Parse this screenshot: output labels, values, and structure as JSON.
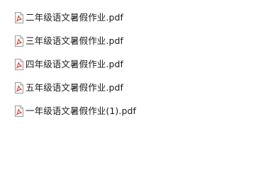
{
  "files": [
    {
      "name": "二年级语文暑假作业.pdf",
      "icon": "pdf-file-icon"
    },
    {
      "name": "三年级语文暑假作业.pdf",
      "icon": "pdf-file-icon"
    },
    {
      "name": "四年级语文暑假作业.pdf",
      "icon": "pdf-file-icon"
    },
    {
      "name": "五年级语文暑假作业.pdf",
      "icon": "pdf-file-icon"
    },
    {
      "name": "一年级语文暑假作业(1).pdf",
      "icon": "pdf-file-icon"
    }
  ],
  "colors": {
    "pdf_accent": "#e23a2e",
    "text": "#1a1a1a",
    "background": "#ffffff"
  }
}
